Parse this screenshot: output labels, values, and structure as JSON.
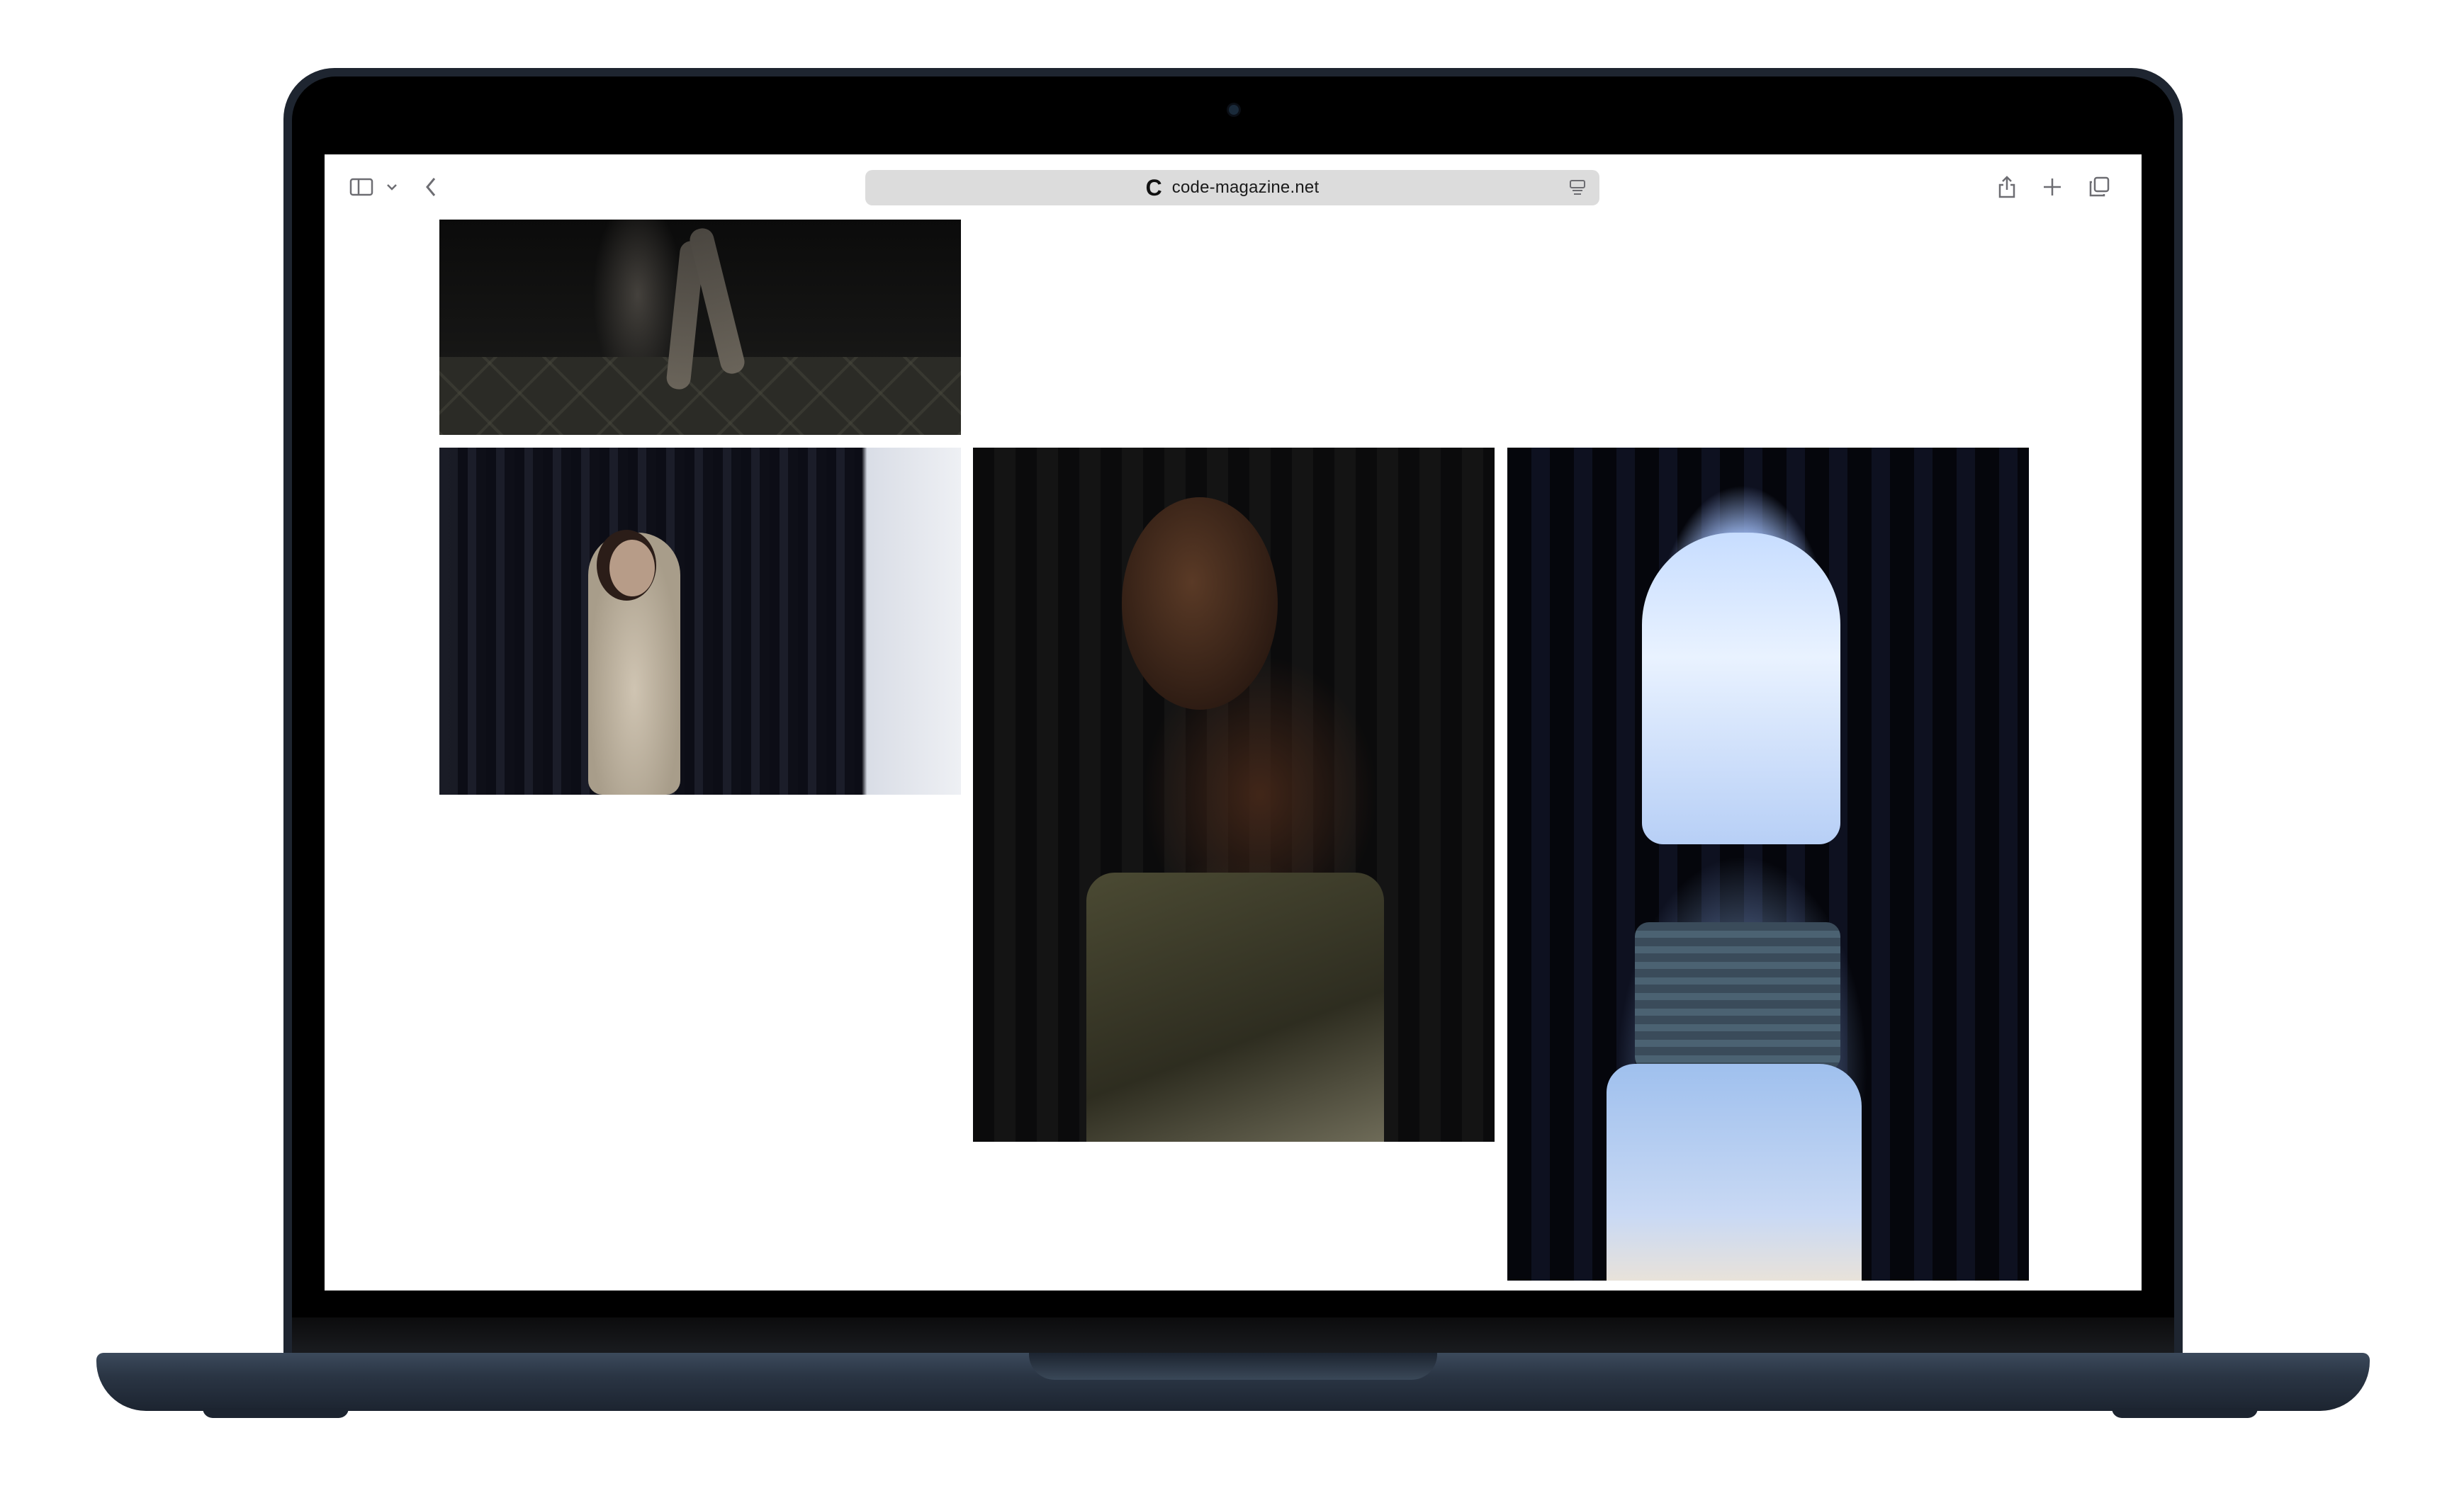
{
  "browser": {
    "url": "code-magazine.net",
    "favicon_letter": "C",
    "toolbar_icons": [
      "sidebar-icon",
      "chevron-down-icon",
      "back-arrow-icon",
      "reader-icon",
      "share-icon",
      "plus-icon",
      "tabs-icon"
    ]
  },
  "page": {
    "photos": [
      {
        "name": "photo-legs-on-tiled-floor"
      },
      {
        "name": "photo-model-in-sequin-dress-curtain"
      },
      {
        "name": "photo-model-portrait-metallic-top"
      },
      {
        "name": "photo-model-back-white-hair"
      }
    ]
  },
  "colors": {
    "page_background": "#ffffff",
    "address_bar": "#dcdcdc",
    "laptop_body": "#1e2530"
  }
}
